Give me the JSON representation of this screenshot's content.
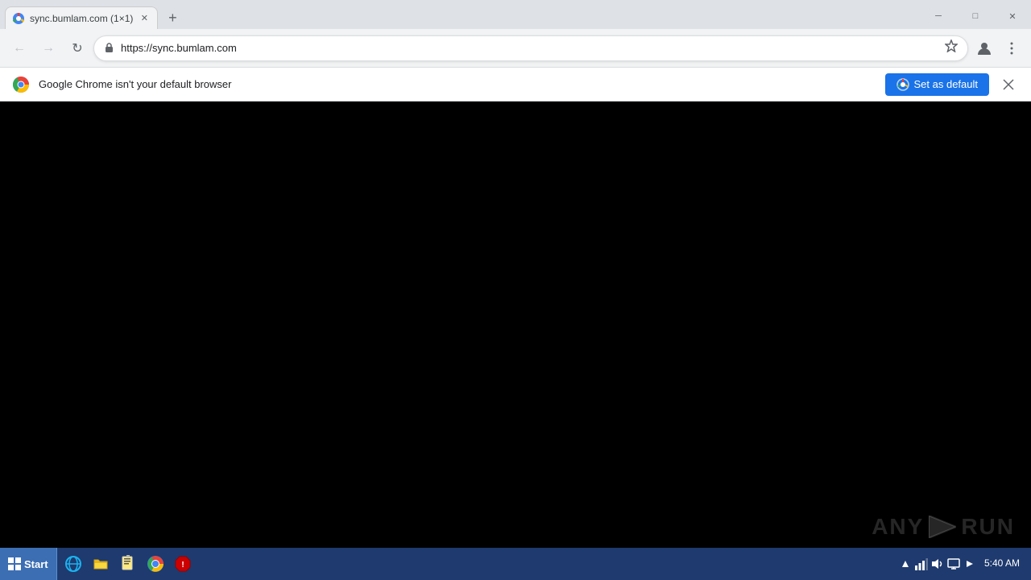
{
  "window": {
    "title": "sync.bumlam.com (1×1)",
    "controls": {
      "minimize": "─",
      "maximize": "□",
      "close": "✕"
    }
  },
  "tab": {
    "title": "sync.bumlam.com (1×1)",
    "close": "✕"
  },
  "new_tab_button": "+",
  "nav": {
    "back": "←",
    "forward": "→",
    "refresh": "↻",
    "url": "https://sync.bumlam.com",
    "star": "☆",
    "account": "👤",
    "menu": "⋮",
    "lock": "🔒"
  },
  "notification": {
    "text": "Google Chrome isn't your default browser",
    "button_label": "Set as default",
    "close": "✕"
  },
  "taskbar": {
    "start_label": "Start",
    "start_icon": "⊞",
    "time": "5:40 AM"
  },
  "anyrun": {
    "text": "ANY",
    "suffix": "RUN"
  }
}
